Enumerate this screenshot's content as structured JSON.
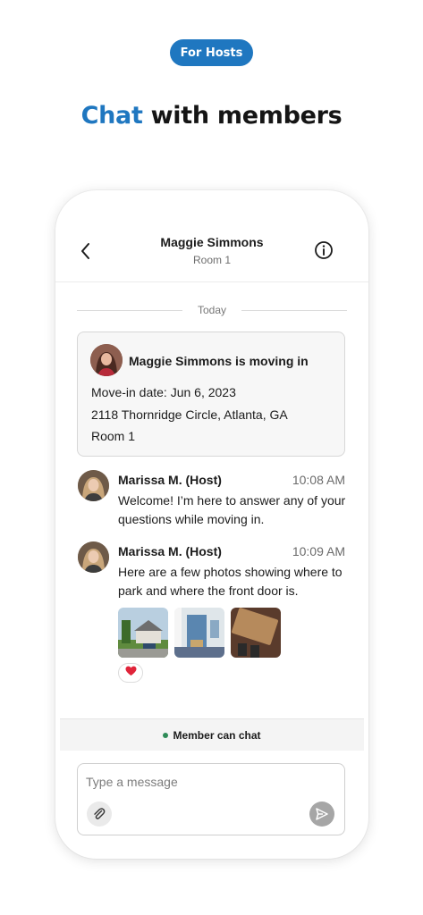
{
  "banner": {
    "pill_label": "For Hosts",
    "headline_accent": "Chat",
    "headline_rest": " with members"
  },
  "header": {
    "title": "Maggie Simmons",
    "subtitle": "Room 1",
    "back_icon": "chevron-left-icon",
    "info_icon": "info-icon"
  },
  "divider_label": "Today",
  "move_in_card": {
    "title": "Maggie Simmons is moving in",
    "move_in_date": "Move-in date: Jun 6, 2023",
    "address": "2118 Thornridge Circle, Atlanta, GA",
    "room": "Room 1"
  },
  "messages": [
    {
      "sender": "Marissa M. (Host)",
      "time": "10:08 AM",
      "text": "Welcome! I’m here to answer any of your questions while moving in."
    },
    {
      "sender": "Marissa M. (Host)",
      "time": "10:09 AM",
      "text": "Here are a few photos showing where to park and where the front door is.",
      "photos": [
        "house-exterior-photo",
        "front-porch-photo",
        "welcome-mat-photo"
      ],
      "reaction": "❤️"
    }
  ],
  "status": {
    "label": "Member can chat",
    "dot_color": "#2e8b57"
  },
  "composer": {
    "placeholder": "Type a message",
    "attach_icon": "paperclip-icon",
    "send_icon": "send-icon"
  },
  "colors": {
    "brand_blue": "#1f77c0",
    "send_disabled": "#a6a6a6"
  }
}
